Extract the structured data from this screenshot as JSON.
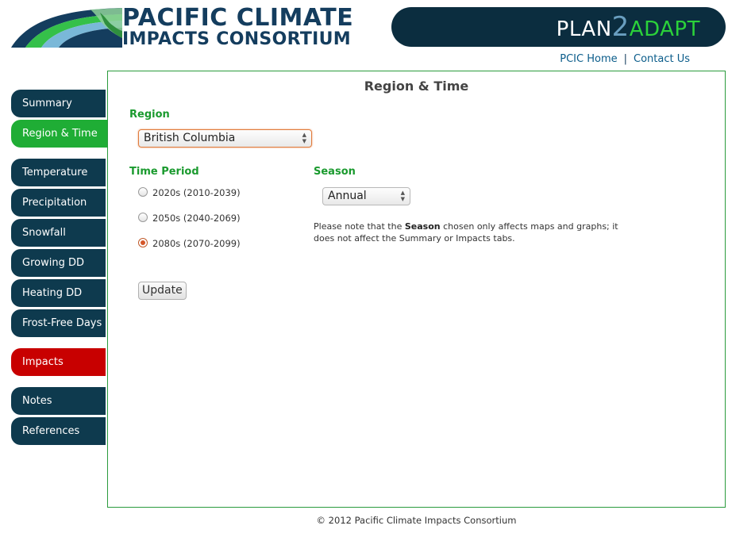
{
  "header": {
    "logo_line1": "PACIFIC CLIMATE",
    "logo_line2": "IMPACTS CONSORTIUM",
    "banner_plan": "PLAN",
    "banner_two": "2",
    "banner_adapt": "ADAPT",
    "links": [
      {
        "label": "PCIC Home"
      },
      {
        "label": "Contact Us"
      }
    ],
    "separator": "|"
  },
  "sidebar": {
    "items": [
      {
        "label": "Summary"
      },
      {
        "label": "Region & Time"
      },
      {
        "label": "Temperature"
      },
      {
        "label": "Precipitation"
      },
      {
        "label": "Snowfall"
      },
      {
        "label": "Growing DD"
      },
      {
        "label": "Heating DD"
      },
      {
        "label": "Frost-Free Days"
      },
      {
        "label": "Impacts"
      },
      {
        "label": "Notes"
      },
      {
        "label": "References"
      }
    ],
    "active": "Region & Time",
    "colors": {
      "default": "#0e3a4e",
      "active": "#1fad35",
      "impacts": "#c80000"
    }
  },
  "main": {
    "title": "Region & Time",
    "region": {
      "label": "Region",
      "selected": "British Columbia"
    },
    "time_period": {
      "label": "Time Period",
      "options": [
        {
          "label": "2020s (2010-2039)",
          "checked": false
        },
        {
          "label": "2050s (2040-2069)",
          "checked": false
        },
        {
          "label": "2080s (2070-2099)",
          "checked": true
        }
      ]
    },
    "season": {
      "label": "Season",
      "selected": "Annual",
      "note_prefix": "Please note that the ",
      "note_bold": "Season",
      "note_suffix": " chosen only affects maps and graphs; it does not affect the Summary or Impacts tabs."
    },
    "update_label": "Update"
  },
  "footer": {
    "text": "© 2012 Pacific Climate Impacts Consortium"
  },
  "colors": {
    "accent_green": "#1a9a2e",
    "navy": "#143d5e",
    "panel_border": "#2a9b3c"
  }
}
